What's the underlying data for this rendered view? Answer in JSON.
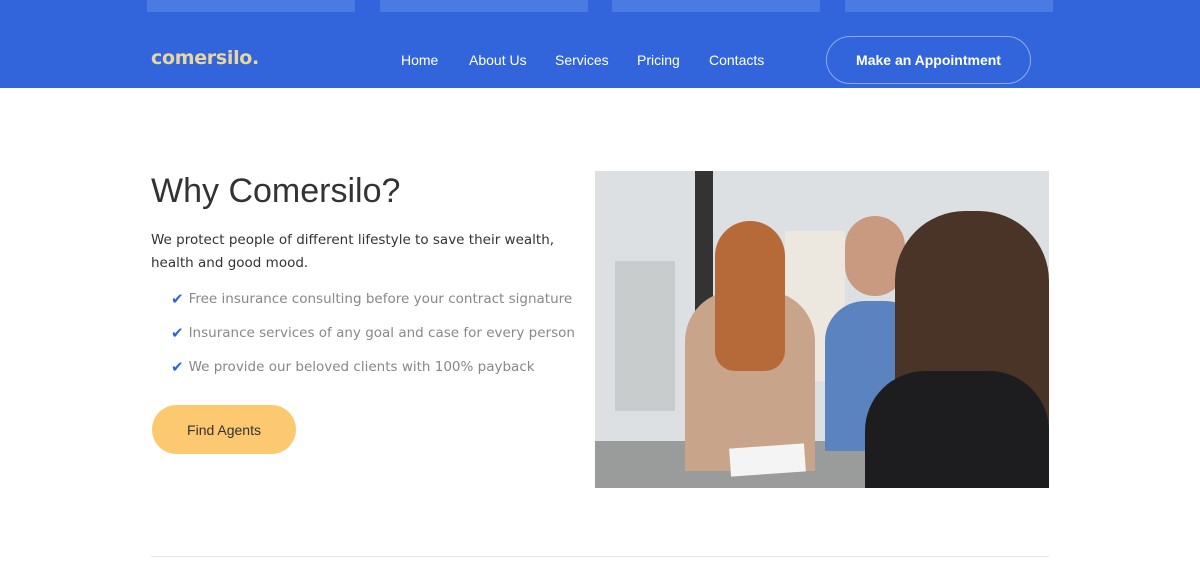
{
  "header": {
    "logo": "comersilo.",
    "nav": [
      "Home",
      "About Us",
      "Services",
      "Pricing",
      "Contacts"
    ],
    "cta": "Make an Appointment"
  },
  "main": {
    "title": "Why Comersilo?",
    "lead": "We protect people of different lifestyle to save their wealth, health and good mood.",
    "features": [
      "Free insurance consulting before your contract signature",
      "Insurance services of any goal and case for every person",
      "We provide our beloved clients with 100% payback"
    ],
    "button": "Find Agents"
  },
  "colors": {
    "brand": "#3265dc",
    "accent": "#fdc970"
  }
}
